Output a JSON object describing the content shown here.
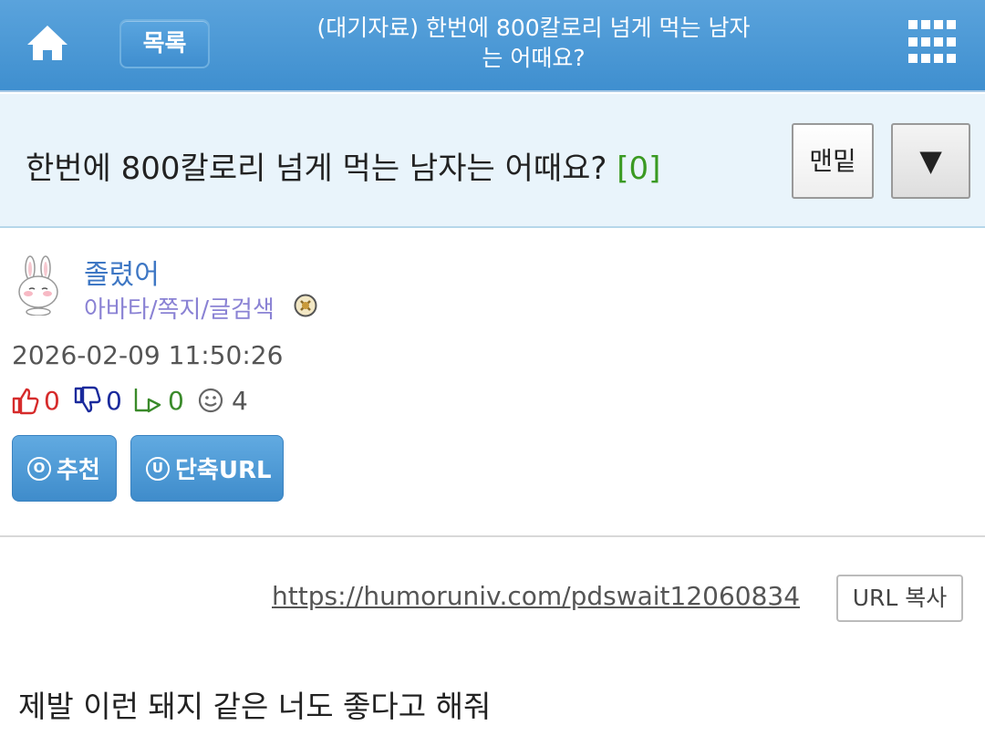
{
  "header": {
    "home_icon": "home-icon",
    "list_label": "목록",
    "title_line1": "(대기자료) 한번에 800칼로리 넘게 먹는 남자",
    "title_line2": "는 어때요?",
    "menu_icon": "grid-menu-icon"
  },
  "post": {
    "title": "한번에 800칼로리 넘게 먹는 남자는 어때요?",
    "comment_count": "[0]",
    "bottom_label": "맨밑",
    "down_label": "▼"
  },
  "author": {
    "name": "졸렸어",
    "links": "아바타/쪽지/글검색",
    "avatar_icon": "rabbit-avatar",
    "badge_icon": "badge-icon"
  },
  "meta": {
    "date": "2026-02-09 11:50:26",
    "likes": "0",
    "dislikes": "0",
    "shares": "0",
    "views": "4"
  },
  "actions": {
    "recommend_label": "추천",
    "recommend_icon_char": "O",
    "shorturl_label": "단축URL",
    "shorturl_icon_char": "U"
  },
  "link": {
    "url": "https://humoruniv.com/pdswait12060834",
    "copy_label": "URL 복사"
  },
  "content": {
    "text": "제발 이런 돼지 같은 너도 좋다고 해줘"
  },
  "colors": {
    "header_blue": "#4a98d6",
    "title_band": "#e9f4fb",
    "like_red": "#d62b2b",
    "dislike_navy": "#1a2a9c",
    "share_green": "#3a8a2a",
    "count_green": "#3a9a22"
  }
}
